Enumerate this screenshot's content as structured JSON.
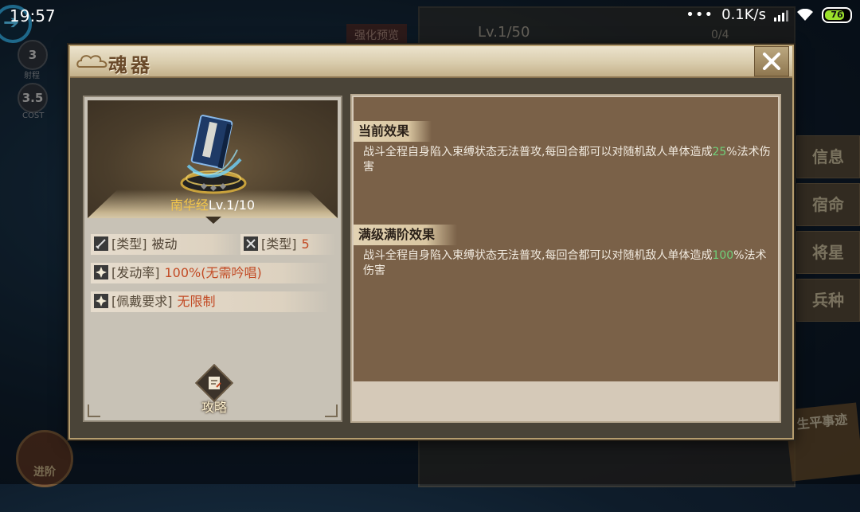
{
  "status_bar": {
    "time": "19:57",
    "net_speed": "0.1K/s",
    "battery": "76"
  },
  "background": {
    "top_tag": "强化预览",
    "level": "Lv.1/50",
    "count": "0/4",
    "badge1_value": "3",
    "badge1_label": "射程",
    "badge2_value": "3.5",
    "badge2_label": "COST",
    "tabs": [
      "信息",
      "宿命",
      "将星",
      "兵种"
    ],
    "bottom_left_button": "进阶",
    "bottom_right_scroll": "生平事迹"
  },
  "dialog": {
    "title": "魂器",
    "item": {
      "name": "南华经",
      "level": "Lv.1/10"
    },
    "attributes": {
      "type_label": "[类型]",
      "type_value": "被动",
      "type2_label": "[类型]",
      "type2_value": "5",
      "trigger_label": "[发动率]",
      "trigger_value": "100%(无需吟唱)",
      "equip_label": "[佩戴要求]",
      "equip_value": "无限制"
    },
    "guide_label": "攻略",
    "current_effect": {
      "title": "当前效果",
      "text_before": "战斗全程自身陷入束缚状态无法普攻,每回合都可以对随机敌人单体造成",
      "value": "25",
      "text_after": "%法术伤害"
    },
    "max_effect": {
      "title": "满级满阶效果",
      "text_before": "战斗全程自身陷入束缚状态无法普攻,每回合都可以对随机敌人单体造成",
      "value": "100",
      "text_after": "%法术伤害"
    }
  },
  "colors": {
    "highlight_number": "#6fd07a",
    "item_name": "#f3c64c",
    "attr_value": "#c24a24"
  }
}
